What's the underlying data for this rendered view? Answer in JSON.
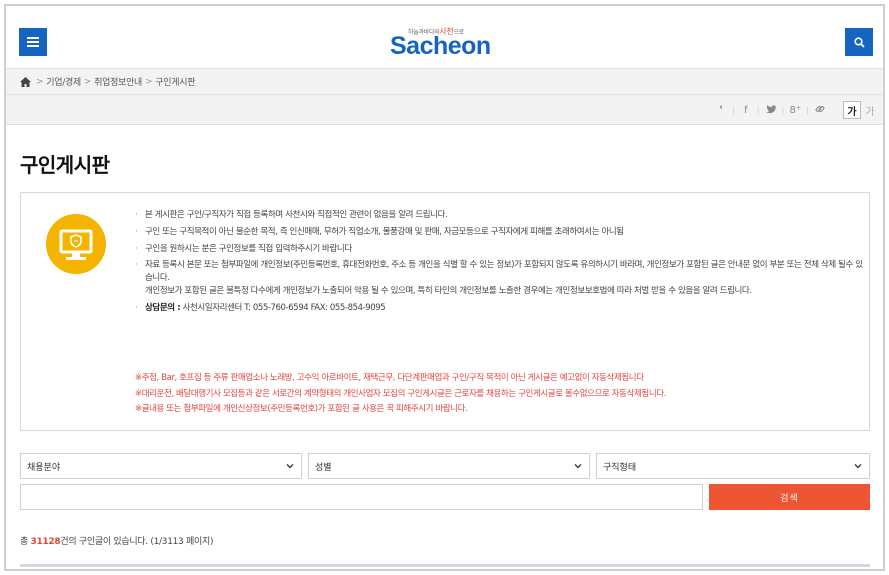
{
  "header": {
    "logo_tagline": "하늘과바다와",
    "logo_tagline_brand": "사천",
    "logo_tagline_end": "으로",
    "logo_text": "Sacheon",
    "menu_icon": "hamburger-menu-icon",
    "search_icon": "search-icon",
    "brand_color": "#1565c0"
  },
  "breadcrumb": {
    "home_icon": "home-icon",
    "items": [
      "기업/경제",
      "취업정보안내",
      "구인게시판"
    ]
  },
  "share": {
    "icons": [
      "cafe-icon",
      "facebook-icon",
      "twitter-icon",
      "google-plus-icon",
      "link-icon"
    ],
    "glyphs": [
      "❜",
      "f",
      "🐦",
      "8⁺",
      "🔗"
    ],
    "font_large": "가",
    "font_small": "가"
  },
  "page": {
    "title": "구인게시판"
  },
  "notice": {
    "icon": "monitor-icon",
    "items": [
      "본 게시판은 구인/구직자가 직접 등록하며 사천시와 직접적인 관련이 없음을 알려 드립니다.",
      "구인 또는 구직목적이 아닌 불순한 목적, 즉 인신매매, 무허가 직업소개, 물품강매 및 판매, 자금모등으로 구직자에게 피해를 초래하여서는 아니됨",
      "구인을 원하시는 분은 구인정보를 직접 입력하주시기 바랍니다",
      "자료 등록시 본문 또는 첨부파일에 개인정보(주민등록번호, 휴대전화번호, 주소 등 개인을 식별 할 수 있는 정보)가 포함되지 않도록 유의하시기 바라며, 개인정보가 포함된 글은 안내문 없이 부분 또는 전체 삭제 될수 있습니다.",
      "개인정보가 포함된 글은 불특정 다수에게 개인정보가 노출되어 악용 될 수 있으며, 특히 타인의 개인정보를 노출한 경우에는 개인정보보호법에 따라 처벌 받을 수 있음을 알려 드립니다."
    ],
    "contact_label": "상담문의 :",
    "contact_value": "사천시일자리센터 T: 055-760-6594 FAX: 055-854-9095",
    "warnings": [
      "※주점, Bar, 호프집 등 주류 판매업소나 노래방, 고수익 아르바이트, 재택근무, 다단계판매업과 구인/구직 목적이 아닌 게시글은 예고없이 자동삭제됩니다",
      "※대리운전, 배달대행기사 모집등과 같은 서로간의 계약형태의 개인사업자 모집의 구인게시글은 근로자를 채용하는 구인게시글로 볼수없으므로 자동삭제됩니다.",
      "※글내용 또는 첨부파일에 개인신상정보(주민등록번호)가 포함된 글 사용은 꼭 피해주시기 바랍니다."
    ],
    "warning_color": "#e6463c"
  },
  "search": {
    "field_select": "채용분야",
    "gender_select": "성별",
    "type_select": "구직형태",
    "keyword_value": "",
    "submit_label": "검색",
    "submit_color": "#ee5533"
  },
  "results": {
    "prefix": "총 ",
    "count": "31128",
    "suffix": "건의 구인글이 있습니다. (1/3113 페이지)"
  }
}
